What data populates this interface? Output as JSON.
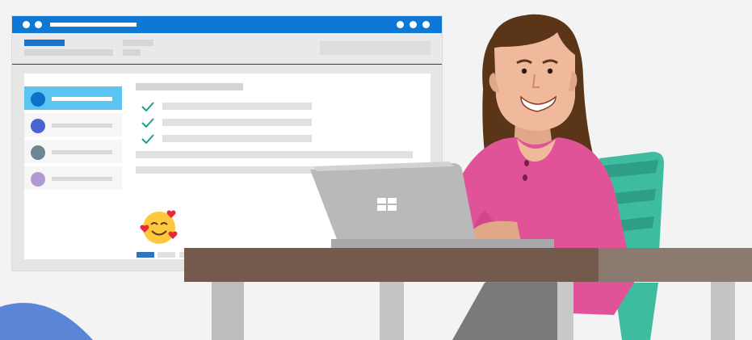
{
  "scene": {
    "description_icons": [
      "browser-window",
      "checkmark-icon",
      "smiling-hearts-emoji-icon",
      "windows-logo-icon",
      "laptop",
      "chair",
      "desk"
    ],
    "colors": {
      "titlebar": "#0f78d4",
      "sidebar_active": "#5bc4f1",
      "check": "#1aa38a",
      "shirt": "#e15399",
      "chair": "#3dbca0",
      "desk_top": "#735a4c",
      "laptop": "#b9b9b9"
    },
    "sidebar_avatars": [
      "#0a73c7",
      "#4a64cf",
      "#6b8791",
      "#b09ad2"
    ]
  }
}
